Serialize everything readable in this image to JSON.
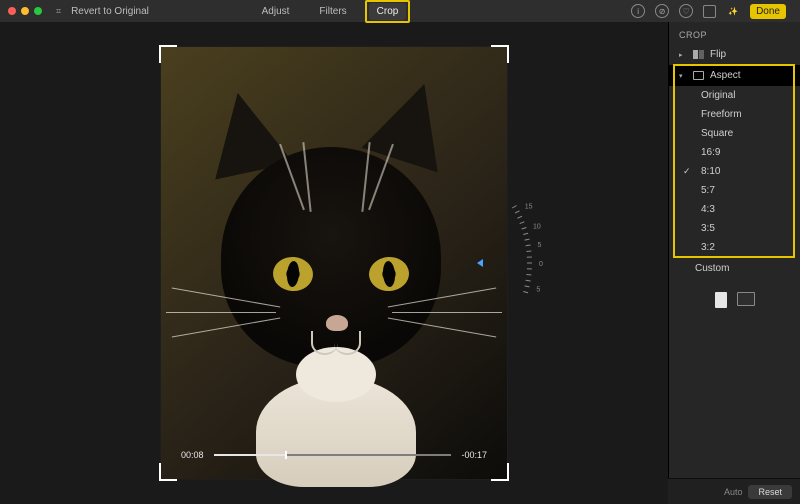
{
  "titlebar": {
    "zoom_label": "⌗",
    "revert": "Revert to Original",
    "tabs": {
      "adjust": "Adjust",
      "filters": "Filters",
      "crop": "Crop"
    },
    "done": "Done"
  },
  "playback": {
    "elapsed": "00:08",
    "remaining": "-00:17",
    "progress_fraction": 0.3
  },
  "dial": {
    "ticks": [
      "15",
      "10",
      "5",
      "0",
      "5"
    ]
  },
  "sidebar": {
    "title": "CROP",
    "flip": "Flip",
    "aspect": "Aspect",
    "options": [
      {
        "label": "Original",
        "selected": false
      },
      {
        "label": "Freeform",
        "selected": false
      },
      {
        "label": "Square",
        "selected": false
      },
      {
        "label": "16:9",
        "selected": false
      },
      {
        "label": "8:10",
        "selected": true
      },
      {
        "label": "5:7",
        "selected": false
      },
      {
        "label": "4:3",
        "selected": false
      },
      {
        "label": "3:5",
        "selected": false
      },
      {
        "label": "3:2",
        "selected": false
      }
    ],
    "custom": "Custom"
  },
  "footer": {
    "auto": "Auto",
    "reset": "Reset"
  },
  "colors": {
    "highlight": "#e7c400"
  }
}
